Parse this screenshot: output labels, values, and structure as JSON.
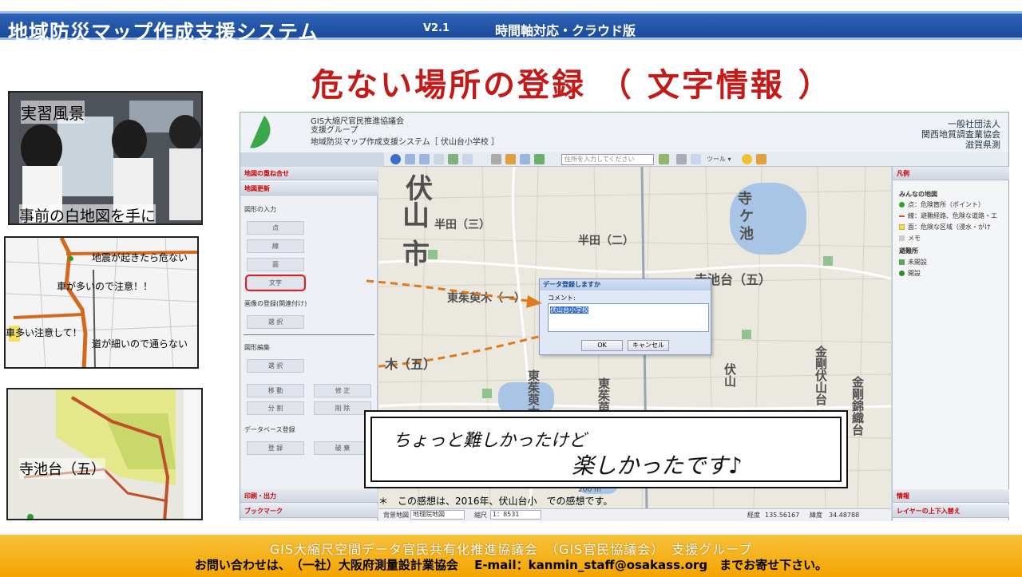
{
  "banner": {
    "title": "地域防災マップ作成支援システム",
    "version": "V2.1",
    "subtitle": "時間軸対応・クラウド版"
  },
  "slide_title": "危ない場所の登録 （ 文字情報 ）",
  "photos": {
    "scene_caption": "実習風景",
    "scene_caption2": "事前の白地図を手に",
    "sketch_notes": [
      "地震が起きたら危ない",
      "車が多いので注意！！",
      "車多い注意して！",
      "道が細いので通らない"
    ],
    "inset_label": "寺池台（五）"
  },
  "app": {
    "header": {
      "council": "GIS大縮尺官民推進協議会",
      "group": "支援グループ",
      "system": "地域防災マップ作成支援システム［ 伏山台小学校 ］",
      "org_right1": "一般社団法人",
      "org_right2": "関西地質調査業協会",
      "org_right3": "滋賀県測"
    },
    "toolbar": {
      "search_placeholder": "住所を入力してください",
      "tools_label": "ツール ▾"
    },
    "left_panel": {
      "section_overlay": "地図の重ね合せ",
      "section_update": "地図更新",
      "shape_input": "図形の入力",
      "btn_point": "点",
      "btn_line": "線",
      "btn_area": "面",
      "btn_text": "文字",
      "image_register": "画像の登録(関連付け)",
      "btn_select1": "選 択",
      "shape_edit": "図形編集",
      "btn_select2": "選 択",
      "btn_move": "移 動",
      "btn_modify": "修 正",
      "btn_split": "分 割",
      "btn_delete": "削 除",
      "db_register": "データベース登録",
      "btn_register": "登 録",
      "btn_cancel": "破 棄",
      "section_print": "印刷・出力",
      "section_bookmark": "ブックマーク"
    },
    "map_labels": [
      "伏",
      "山",
      "市",
      "半田（三）",
      "半田（二）",
      "寺",
      "ケ",
      "池",
      "寺池台（五）",
      "東茱萸木（一）",
      "木（五）",
      "金剛伏山台",
      "金剛錦織台",
      "伏山",
      "東茱萸木",
      "東茱萸",
      "200 m"
    ],
    "dialog": {
      "title": "データ登録しますか",
      "comment_label": "コメント:",
      "comment_value": "伏山台小学校",
      "ok": "OK",
      "cancel": "キャンセル"
    },
    "right_panel": {
      "legend_title": "凡例",
      "group1": "みんなの地図",
      "item1": "点：危険箇所（ポイント）",
      "item2": "線：避難経路、危険な道路・エ",
      "item3": "面：危険な区域（浸水・がけ",
      "item4": "メモ",
      "group2": "避難所",
      "item5": "未開設",
      "item6": "開設",
      "info": "情報",
      "layers": "レイヤーの上下入替え"
    },
    "statusbar": {
      "bg_label": "背景地図",
      "bg_value": "地理院地図",
      "scale_label": "縮尺",
      "scale_value": "1：8531",
      "lon_label": "経度",
      "lon_value": "135.56167",
      "lat_label": "緯度",
      "lat_value": "34.48788"
    }
  },
  "note": {
    "line1": "ちょっと難しかったけど",
    "line2": "楽しかったです♪"
  },
  "footnote": "＊　この感想は、2016年、伏山台小　での感想です。",
  "footer": {
    "line1": "GIS大縮尺空間データ官民共有化推進協議会　（GIS官民協議会）　支援グループ",
    "line2": "お問い合わせは、　（一社）大阪府測量設計業協会　 E-mail：kanmin_staff@osakass.org　までお寄せ下さい。"
  },
  "colors": {
    "banner": "#1b4a9a",
    "title_red": "#c31a1a",
    "footer": "#f4a400",
    "highlight": "#e02020",
    "route_orange": "#d2691e"
  }
}
